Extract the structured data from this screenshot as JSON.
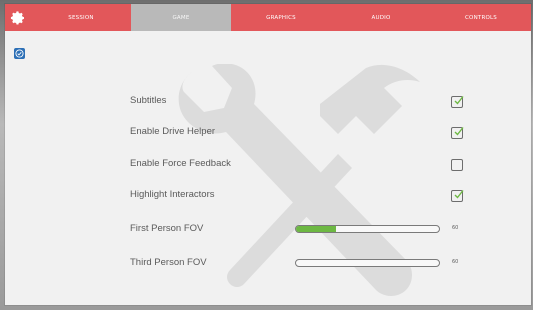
{
  "tabs": [
    {
      "label": "SESSION",
      "active": false
    },
    {
      "label": "GAME",
      "active": true
    },
    {
      "label": "GRAPHICS",
      "active": false
    },
    {
      "label": "AUDIO",
      "active": false
    },
    {
      "label": "CONTROLS",
      "active": false
    }
  ],
  "settings": {
    "subtitles": {
      "label": "Subtitles",
      "checked": true
    },
    "drive_helper": {
      "label": "Enable Drive Helper",
      "checked": true
    },
    "force_feedback": {
      "label": "Enable Force Feedback",
      "checked": false
    },
    "highlight": {
      "label": "Highlight Interactors",
      "checked": true
    },
    "fp_fov": {
      "label": "First Person FOV",
      "value": "60",
      "fill": 0.28
    },
    "tp_fov": {
      "label": "Third Person FOV",
      "value": "60",
      "fill": 0.0
    }
  },
  "colors": {
    "accent": "#e2575a",
    "active_tab": "#b9b9b9",
    "check": "#6db843",
    "side_button": "#2c6fb6"
  },
  "icons": {
    "app": "gear-icon",
    "side": "check-circle-icon",
    "watermark": "wrench-hammer-icon"
  }
}
